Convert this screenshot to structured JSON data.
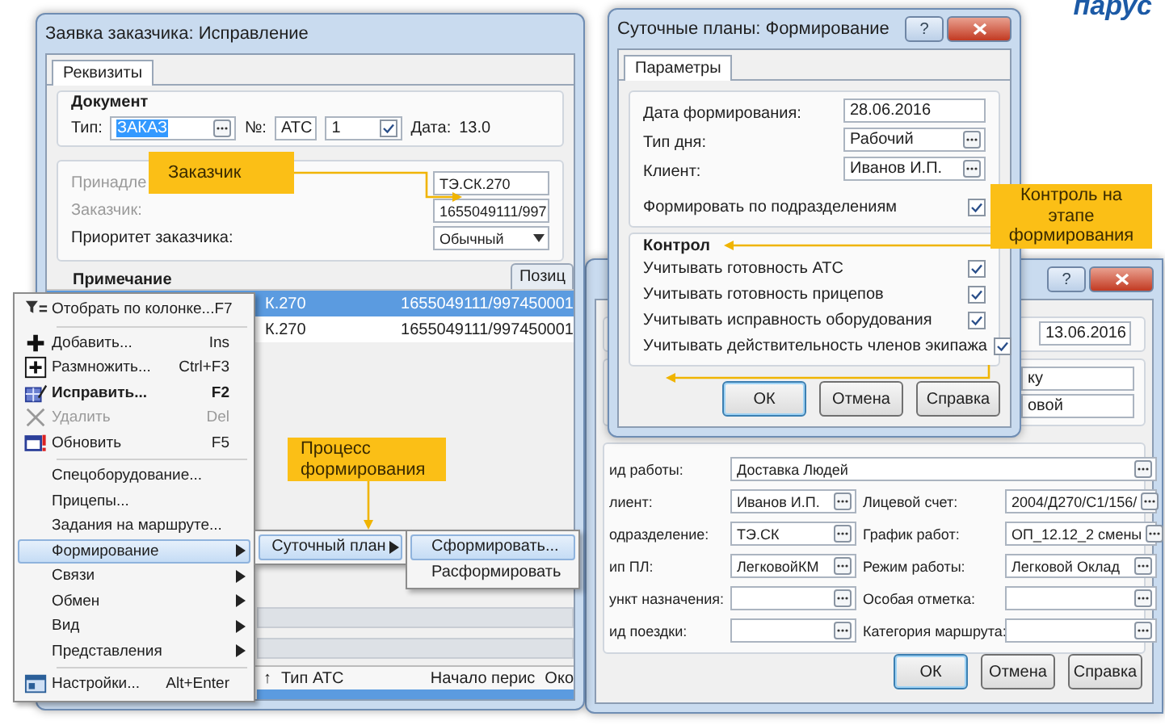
{
  "logo": "парус",
  "order_window": {
    "title": "Заявка заказчика: Исправление",
    "tabs": [
      {
        "label": "Реквизиты",
        "selected": true
      }
    ],
    "document": {
      "heading": "Документ",
      "type_label": "Тип:",
      "type_value": "ЗАКАЗ",
      "number_label": "№:",
      "number_series": "АТС",
      "number_value": "1",
      "number_checked": true,
      "date_label": "Дата:",
      "date_value": "13.0"
    },
    "customer": [
      {
        "label": "Принадле",
        "value": "ТЭ.СК.270",
        "disabled": true,
        "kind": "text"
      },
      {
        "label": "Заказчик:",
        "value": "1655049111/997",
        "disabled": true,
        "kind": "text"
      },
      {
        "label": "Приоритет заказчика:",
        "value": "Обычный",
        "disabled": false,
        "kind": "select"
      }
    ],
    "note_heading": "Примечание",
    "side_tab": "Позиц",
    "table": {
      "rows": [
        {
          "cells": [
            "К.270",
            "1655049111/997450001"
          ],
          "selected": true
        },
        {
          "cells": [
            "К.270",
            "1655049111/997450001"
          ],
          "selected": false
        }
      ]
    },
    "bottom_table": {
      "sort_mark": "↑",
      "columns": [
        "Тип АТС",
        "Начало перис",
        "Око"
      ]
    }
  },
  "plan_window": {
    "title": "Суточные планы: Формирование",
    "help_button": "?",
    "tabs": [
      {
        "label": "Параметры",
        "selected": true
      }
    ],
    "fields": [
      {
        "label": "Дата формирования:",
        "value": "28.06.2016",
        "kind": "text"
      },
      {
        "label": "Тип дня:",
        "value": "Рабочий",
        "kind": "picker"
      },
      {
        "label": "Клиент:",
        "value": "Иванов И.П.",
        "kind": "picker"
      }
    ],
    "by_division": {
      "label": "Формировать по подразделениям",
      "checked": true
    },
    "control": {
      "heading": "Контрол",
      "items": [
        {
          "label": "Учитывать готовность АТС",
          "checked": true
        },
        {
          "label": "Учитывать готовность прицепов",
          "checked": true
        },
        {
          "label": "Учитывать исправность оборудования",
          "checked": true
        },
        {
          "label": "Учитывать действительность членов экипажа",
          "checked": true
        }
      ]
    },
    "buttons": [
      {
        "label": "ОК",
        "default": true
      },
      {
        "label": "Отмена",
        "default": false
      },
      {
        "label": "Справка",
        "default": false
      }
    ]
  },
  "trip_window": {
    "help_button": "?",
    "date_value": "13.06.2016",
    "upper_values": [
      "ку",
      "овой"
    ],
    "work_type": {
      "label": "ид работы:",
      "value": "Доставка Людей"
    },
    "rows": [
      {
        "label": "лиент:",
        "value": "Иванов И.П.",
        "right_label": "Лицевой счет:",
        "right_value": "2004/Д270/С1/156/"
      },
      {
        "label": "одразделение:",
        "value": "ТЭ.СК",
        "right_label": "График работ:",
        "right_value": "ОП_12.12_2 смены"
      },
      {
        "label": "ип ПЛ:",
        "value": "ЛегковойКМ",
        "right_label": "Режим работы:",
        "right_value": "Легковой Оклад"
      },
      {
        "label": "ункт назначения:",
        "right_label": "Особая отметка:"
      },
      {
        "label": "ид поездки:",
        "right_label": "Категория маршрута:"
      }
    ],
    "buttons": [
      {
        "label": "ОК",
        "default": true
      },
      {
        "label": "Отмена",
        "default": false
      },
      {
        "label": "Справка",
        "default": false
      }
    ]
  },
  "context_menu": {
    "items": [
      {
        "kind": "filter",
        "label": "Отобрать по колонке...",
        "shortcut": "F7",
        "bold": false,
        "disabled": false,
        "selected": false,
        "has_submenu": false
      },
      {
        "kind": "separator"
      },
      {
        "kind": "add",
        "label": "Добавить...",
        "shortcut": "Ins",
        "bold": false,
        "disabled": false,
        "selected": false,
        "has_submenu": false
      },
      {
        "kind": "copy",
        "label": "Размножить...",
        "shortcut": "Ctrl+F3",
        "bold": false,
        "disabled": false,
        "selected": false,
        "has_submenu": false
      },
      {
        "kind": "edit",
        "label": "Исправить...",
        "shortcut": "F2",
        "bold": true,
        "disabled": false,
        "selected": false,
        "has_submenu": false
      },
      {
        "kind": "delete",
        "label": "Удалить",
        "shortcut": "Del",
        "bold": false,
        "disabled": true,
        "selected": false,
        "has_submenu": false
      },
      {
        "kind": "refresh",
        "label": "Обновить",
        "shortcut": "F5",
        "bold": false,
        "disabled": false,
        "selected": false,
        "has_submenu": false
      },
      {
        "kind": "separator"
      },
      {
        "kind": "item",
        "label": "Спецоборудование...",
        "bold": false,
        "disabled": false,
        "selected": false,
        "has_submenu": false
      },
      {
        "kind": "item",
        "label": "Прицепы...",
        "bold": false,
        "disabled": false,
        "selected": false,
        "has_submenu": false
      },
      {
        "kind": "item",
        "label": "Задания на маршруте...",
        "bold": false,
        "disabled": false,
        "selected": false,
        "has_submenu": false
      },
      {
        "kind": "item",
        "label": "Формирование",
        "bold": false,
        "disabled": false,
        "selected": true,
        "has_submenu": true
      },
      {
        "kind": "item",
        "label": "Связи",
        "bold": false,
        "disabled": false,
        "selected": false,
        "has_submenu": true
      },
      {
        "kind": "item",
        "label": "Обмен",
        "bold": false,
        "disabled": false,
        "selected": false,
        "has_submenu": true
      },
      {
        "kind": "item",
        "label": "Вид",
        "bold": false,
        "disabled": false,
        "selected": false,
        "has_submenu": true
      },
      {
        "kind": "item",
        "label": "Представления",
        "bold": false,
        "disabled": false,
        "selected": false,
        "has_submenu": true
      },
      {
        "kind": "separator"
      },
      {
        "kind": "settings",
        "label": "Настройки...",
        "shortcut": "Alt+Enter",
        "bold": false,
        "disabled": false,
        "selected": false,
        "has_submenu": false
      }
    ]
  },
  "submenu": {
    "items": [
      {
        "label": "Суточный план",
        "selected": true,
        "has_submenu": true
      }
    ]
  },
  "submenu_2": {
    "items": [
      {
        "label": "Сформировать...",
        "selected": true
      },
      {
        "label": "Расформировать",
        "selected": false
      }
    ]
  },
  "callouts": [
    {
      "text": "Заказчик"
    },
    {
      "text": "Процесс формирования"
    },
    {
      "text": "Контроль на этапе формирования"
    }
  ]
}
